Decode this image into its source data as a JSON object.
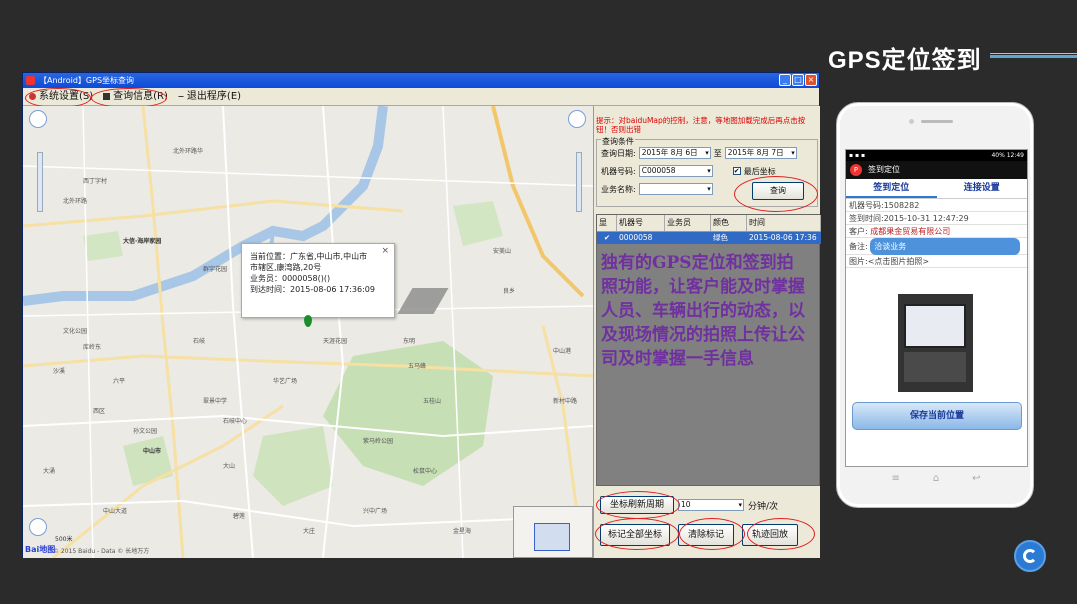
{
  "slide": {
    "title": "GPS定位签到"
  },
  "window": {
    "title": "【Android】GPS坐标查询",
    "menu": [
      {
        "label": "系统设置(S)"
      },
      {
        "label": "查询信息(R)"
      },
      {
        "label": "退出程序(E)"
      }
    ]
  },
  "map": {
    "popup": {
      "line1": "当前位置：广东省,中山市,中山市",
      "line2": "市辖区,康湾路,20号",
      "line3": "业务员：0000058()()",
      "line4": "到达时间：2015-08-06 17:36:09",
      "close": "×"
    },
    "labels": [
      "北外环路",
      "北外环路华",
      "西丁字村",
      "大信·海岸家园",
      "群宇花园",
      "文化公园",
      "石岐",
      "中山市",
      "沙溪",
      "大山",
      "六平",
      "五桂山",
      "中山港",
      "松鼠中心",
      "兴中广场",
      "翠景中学",
      "库岭东",
      "紫马岭公园",
      "石岐中心",
      "天涯花园",
      "良乡",
      "新村中路",
      "五马峰",
      "中山大道",
      "金星海",
      "大涌",
      "碧莲",
      "东明",
      "大庄",
      "西区",
      "华艺广场",
      "孙文公园",
      "安美山"
    ],
    "scale": "500米",
    "copyright": "© 2015 Baidu - Data © 长地万方",
    "baidu": "Bai地图"
  },
  "panel": {
    "warning": "提示：对baiduMap的控制，注意，等地图加载完成后再点击按钮！否则出错",
    "query_group": "查询条件",
    "date_label": "查询日期:",
    "date_from": "2015年 8月 6日",
    "date_to_label": "至",
    "date_to": "2015年 8月 7日",
    "device_label": "机器号码:",
    "device_value": "C000058",
    "latest_label": "最后坐标",
    "biz_label": "业务名称:",
    "biz_value": "",
    "query_button": "查询",
    "grid_headers": [
      "显示",
      "机器号",
      "业务员",
      "颜色",
      "时间"
    ],
    "grid_rows": [
      {
        "show": "✔",
        "device": "0000058",
        "staff": "",
        "color": "绿色",
        "time": "2015-08-06 17:36"
      }
    ],
    "callout": "独有的GPS定位和签到拍照功能，让客户能及时掌握人员、车辆出行的动态，以及现场情况的拍照上传让公司及时掌握一手信息",
    "refresh_label": "坐标刷新周期",
    "refresh_value": "10",
    "refresh_unit": "分钟/次",
    "mark_all_button": "标记全部坐标",
    "clear_button": "清除标记",
    "playback_button": "轨迹回放"
  },
  "phone": {
    "status_time": "12:49",
    "status_battery": "40%",
    "app_title": "签到定位",
    "tabs": [
      {
        "label": "签到定位"
      },
      {
        "label": "连接设置"
      }
    ],
    "device": "机器号码:1508282",
    "signin_time": "签到时间:2015-10-31 12:47:29",
    "customer_label": "客户:",
    "customer_value": "成都果金贸易有限公司",
    "note_label": "备注:",
    "note_value": "洽谈业务",
    "photo_label": "图片:<点击图片拍照>",
    "save_button": "保存当前位置"
  },
  "colors": {
    "accent": "#7030a0",
    "highlight": "#e02020",
    "selection": "#316ac5"
  }
}
